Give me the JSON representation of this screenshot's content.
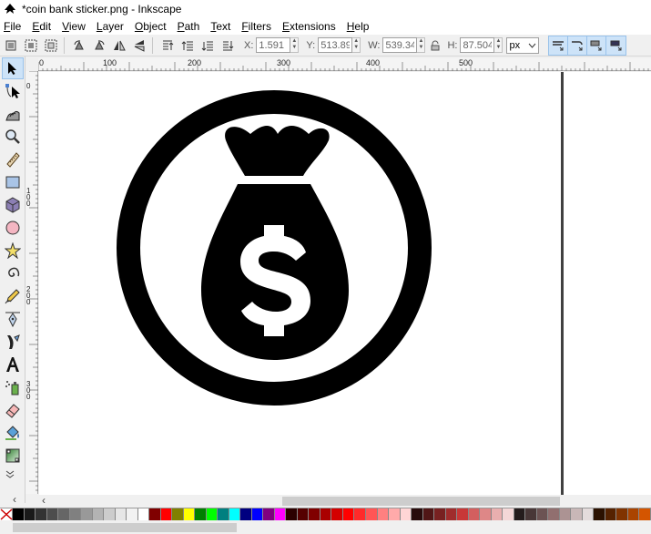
{
  "window": {
    "title": "*coin bank sticker.png - Inkscape"
  },
  "menu": [
    {
      "first": "F",
      "rest": "ile"
    },
    {
      "first": "E",
      "rest": "dit"
    },
    {
      "first": "V",
      "rest": "iew"
    },
    {
      "first": "L",
      "rest": "ayer"
    },
    {
      "first": "O",
      "rest": "bject"
    },
    {
      "first": "P",
      "rest": "ath"
    },
    {
      "first": "T",
      "rest": "ext"
    },
    {
      "first": "F",
      "rest": "ilters"
    },
    {
      "first": "E",
      "rest": "xtensions"
    },
    {
      "first": "H",
      "rest": "elp"
    }
  ],
  "controls": {
    "x_label": "X:",
    "x_value": "1.591",
    "y_label": "Y:",
    "y_value": "513.890",
    "w_label": "W:",
    "w_value": "539.346",
    "h_label": "H:",
    "h_value": "87.504",
    "unit": "px"
  },
  "ruler": {
    "top_labels": [
      "0",
      "100",
      "200",
      "300",
      "400",
      "500"
    ],
    "left_labels": [
      "0",
      "100",
      "200",
      "300"
    ]
  },
  "scroll": {
    "left_arrow": "‹",
    "corner_arrow": "‹"
  },
  "icons": {
    "tools": [
      "selector-icon",
      "node-icon",
      "tweak-icon",
      "zoom-icon",
      "measure-icon",
      "rectangle-icon",
      "3d-box-icon",
      "ellipse-icon",
      "star-icon",
      "spiral-icon",
      "pencil-icon",
      "pen-icon",
      "calligraphy-icon",
      "text-icon",
      "spray-icon",
      "eraser-icon",
      "bucket-icon",
      "gradient-icon"
    ]
  },
  "palette_colors": [
    "#000000",
    "#1a1a1a",
    "#333333",
    "#4d4d4d",
    "#666666",
    "#808080",
    "#999999",
    "#b3b3b3",
    "#cccccc",
    "#e6e6e6",
    "#f2f2f2",
    "#ffffff",
    "#800000",
    "#ff0000",
    "#808000",
    "#ffff00",
    "#008000",
    "#00ff00",
    "#008080",
    "#00ffff",
    "#000080",
    "#0000ff",
    "#800080",
    "#ff00ff",
    "#2b0000",
    "#550000",
    "#800000",
    "#aa0000",
    "#d40000",
    "#ff0000",
    "#ff2a2a",
    "#ff5555",
    "#ff8080",
    "#ffaaaa",
    "#ffd5d5",
    "#280b0b",
    "#501616",
    "#782121",
    "#a02c2c",
    "#c83737",
    "#d35f5f",
    "#de8787",
    "#e9afaf",
    "#f4d7d7",
    "#241c1c",
    "#483737",
    "#6c5353",
    "#916f6f",
    "#ac9393",
    "#c8b7b7",
    "#e3dbdb",
    "#2b1100",
    "#552200",
    "#803300",
    "#aa4400",
    "#d45500"
  ]
}
